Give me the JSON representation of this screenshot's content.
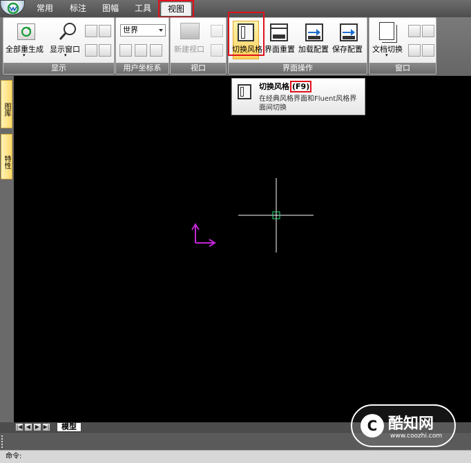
{
  "tabs": [
    {
      "label": "常用"
    },
    {
      "label": "标注"
    },
    {
      "label": "图幅"
    },
    {
      "label": "工具"
    },
    {
      "label": "视图"
    }
  ],
  "ribbon": {
    "display": {
      "title": "显示",
      "regen_all": "全部重生成",
      "display_window": "显示窗口"
    },
    "ucs": {
      "title": "用户坐标系",
      "combo_value": "世界"
    },
    "viewport": {
      "title": "视口",
      "new_viewport": "新建视口"
    },
    "ui_ops": {
      "title": "界面操作",
      "switch_style": "切换风格",
      "reset_ui": "界面重置",
      "load_config": "加载配置",
      "save_config": "保存配置"
    },
    "window": {
      "title": "窗口",
      "doc_switch": "文档切换"
    }
  },
  "tooltip": {
    "title": "切换风格",
    "shortcut": "(F9)",
    "description": "在经典风格界面和Fluent风格界面间切换"
  },
  "left_dock": {
    "tab1": "图库",
    "tab2": "特性"
  },
  "layout_tabs": {
    "model": "模型"
  },
  "status": {
    "command_label": "命令:"
  },
  "watermark": {
    "logo": "C",
    "title": "酷知网",
    "url": "www.coozhi.com"
  },
  "colors": {
    "highlight_red": "#e0101b",
    "ucs_icon": "#c026d3",
    "crosshair": "#ffffff",
    "pickbox": "#2ee07a"
  }
}
